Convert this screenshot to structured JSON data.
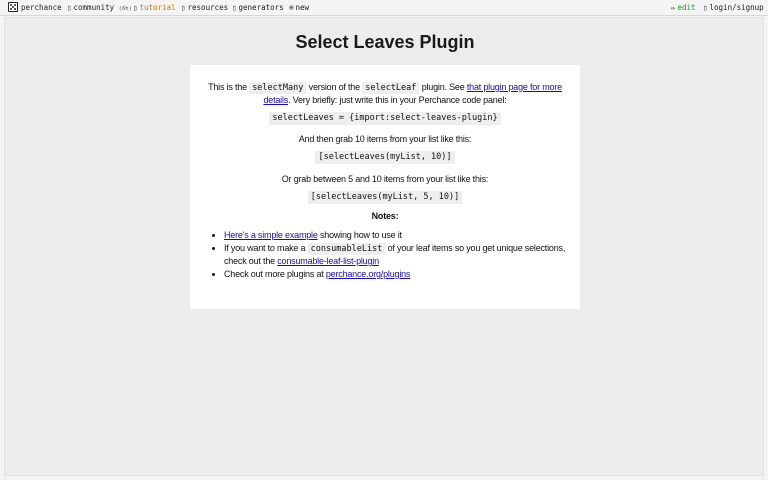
{
  "topbar": {
    "brand": "perchance",
    "community": "community",
    "community_count": "(6h)",
    "tutorial": "tutorial",
    "resources": "resources",
    "generators": "generators",
    "new_label": "new",
    "edit_label": "edit",
    "login_label": "login/signup"
  },
  "page": {
    "title": "Select Leaves Plugin",
    "title_icon_left": "",
    "title_icon_right": ""
  },
  "content": {
    "intro_prefix": "This is the ",
    "intro_code1": "selectMany",
    "intro_mid": " version of the ",
    "intro_code2": "selectLeaf",
    "intro_suffix": " plugin. See ",
    "intro_link": "that plugin page for more details",
    "intro_end": ". Very briefly: just write this in your Perchance code panel:",
    "import_code": "selectLeaves = {import:select-leaves-plugin}",
    "grab_text": "And then grab 10 items from your list like this:",
    "grab_code": "[selectLeaves(myList, 10)]",
    "between_text": "Or grab between 5 and 10 items from your list like this:",
    "between_code": "[selectLeaves(myList, 5, 10)]",
    "notes_title": "Notes:",
    "note1_link": "Here's a simple example",
    "note1_text": " showing how to use it",
    "note2_prefix": "If you want to make a ",
    "note2_code": "consumableList",
    "note2_mid": " of your leaf items so you get unique selections, check out the ",
    "note2_link": "consumable-leaf-list-plugin",
    "note3_prefix": "Check out more plugins at ",
    "note3_link": "perchance.org/plugins"
  }
}
